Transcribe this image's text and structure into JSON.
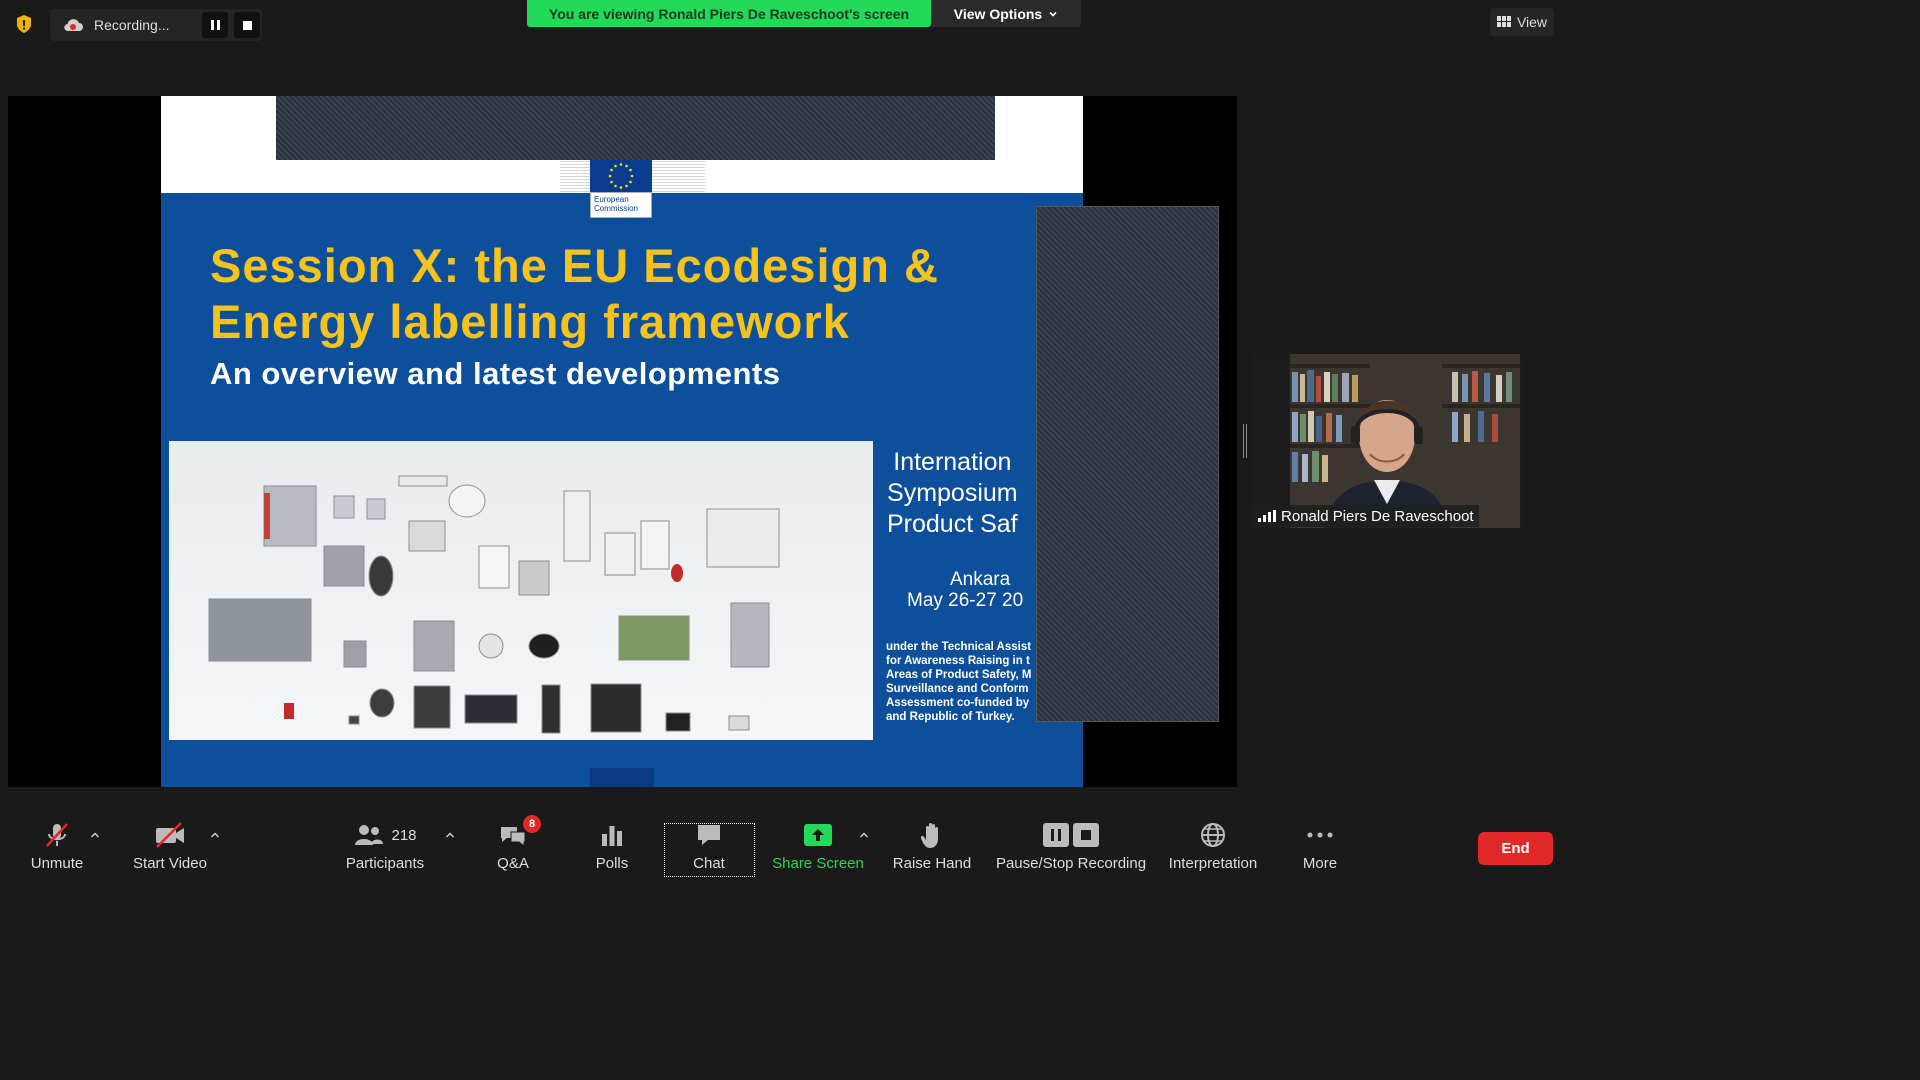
{
  "top_bar": {
    "recording_label": "Recording...",
    "banner": "You are viewing Ronald Piers De Raveschoot's screen",
    "view_options": "View Options",
    "view_label": "View"
  },
  "slide": {
    "logo_text": "European Commission",
    "title_line1": "Session X: the EU Ecodesign &",
    "title_line2": "Energy labelling framework",
    "subtitle": "An overview and latest developments",
    "info_line1": "Internation",
    "info_line2": "Symposium",
    "info_line3": "Product Saf",
    "place": "Ankara",
    "dates": "May 26-27 20",
    "small_lines": [
      "under the Technical Assist",
      "for Awareness Raising in t",
      "Areas of Product Safety, M",
      "Surveillance and Conform",
      "Assessment co-funded by",
      "and Republic of Turkey."
    ]
  },
  "participant": {
    "name": "Ronald Piers De Raveschoot"
  },
  "toolbar": {
    "unmute": "Unmute",
    "start_video": "Start Video",
    "participants_count": "218",
    "participants": "Participants",
    "qa": "Q&A",
    "qa_badge": "8",
    "polls": "Polls",
    "chat": "Chat",
    "share_screen": "Share Screen",
    "raise_hand": "Raise Hand",
    "pause_stop_recording": "Pause/Stop Recording",
    "interpretation": "Interpretation",
    "more": "More",
    "end": "End"
  },
  "colors": {
    "banner_green": "#23d959",
    "share_green": "#23d959",
    "end_red": "#e02828",
    "slide_blue": "#0e4f9b",
    "title_yellow": "#f6c31c"
  }
}
